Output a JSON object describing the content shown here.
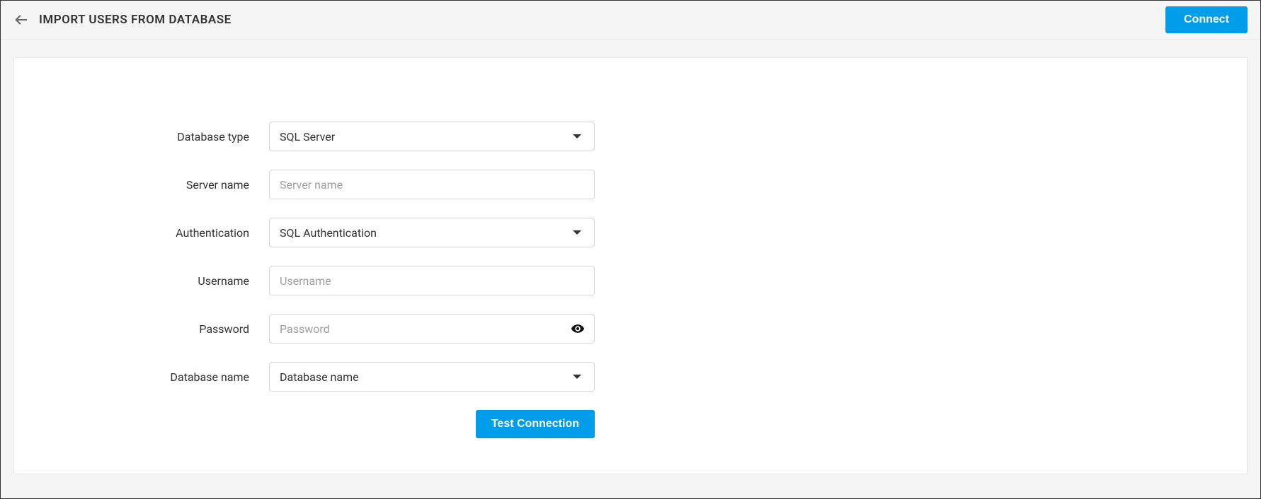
{
  "header": {
    "title": "IMPORT USERS FROM DATABASE",
    "connect_label": "Connect"
  },
  "form": {
    "database_type": {
      "label": "Database type",
      "value": "SQL Server"
    },
    "server_name": {
      "label": "Server name",
      "placeholder": "Server name",
      "value": ""
    },
    "authentication": {
      "label": "Authentication",
      "value": "SQL Authentication"
    },
    "username": {
      "label": "Username",
      "placeholder": "Username",
      "value": ""
    },
    "password": {
      "label": "Password",
      "placeholder": "Password",
      "value": ""
    },
    "database_name": {
      "label": "Database name",
      "value": "Database name"
    },
    "test_connection_label": "Test Connection"
  }
}
